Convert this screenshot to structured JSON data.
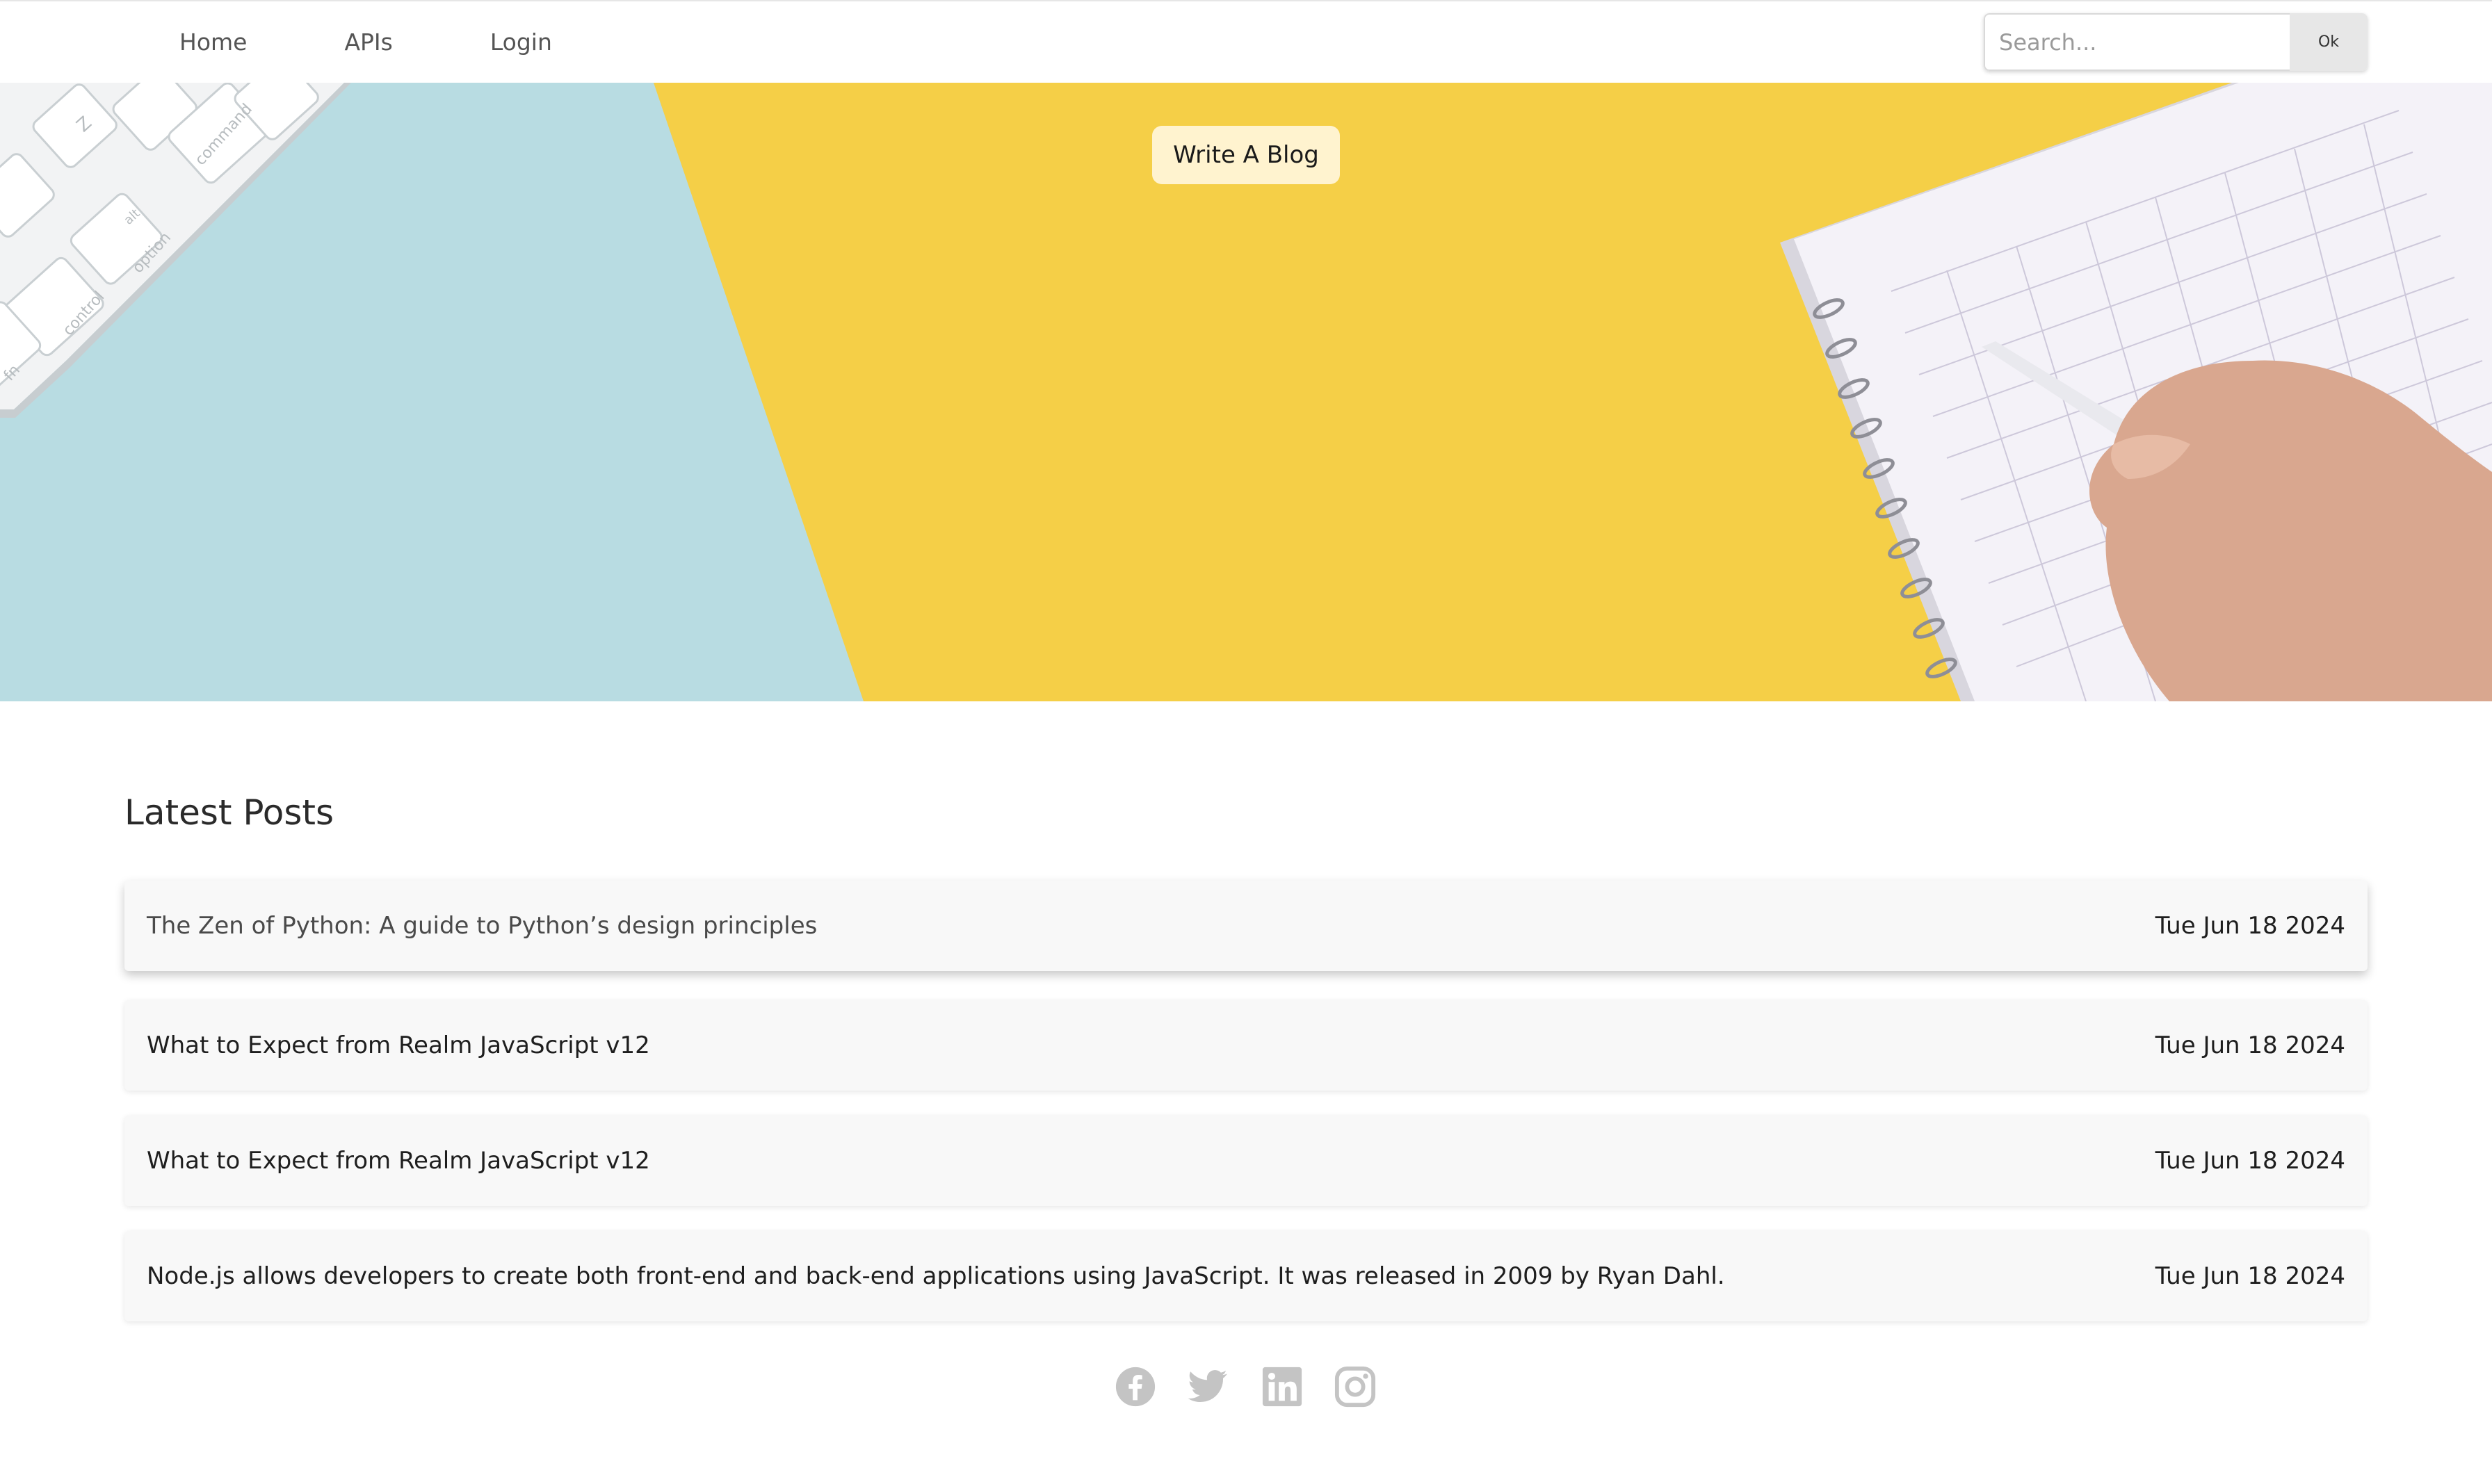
{
  "nav": {
    "links": [
      {
        "label": "Home"
      },
      {
        "label": "APIs"
      },
      {
        "label": "Login"
      }
    ],
    "search": {
      "placeholder": "Search...",
      "button_label": "Ok"
    }
  },
  "hero": {
    "write_blog_label": "Write A Blog",
    "keyboard_keys": [
      "Z",
      "alt",
      "option",
      "control",
      "command",
      "fn"
    ]
  },
  "posts": {
    "title": "Latest Posts",
    "items": [
      {
        "title": "The Zen of Python: A guide to Python’s design principles",
        "date": "Tue Jun 18 2024"
      },
      {
        "title": "What to Expect from Realm JavaScript v12",
        "date": "Tue Jun 18 2024"
      },
      {
        "title": "What to Expect from Realm JavaScript v12",
        "date": "Tue Jun 18 2024"
      },
      {
        "title": "Node.js allows developers to create both front-end and back-end applications using JavaScript. It was released in 2009 by Ryan Dahl.",
        "date": "Tue Jun 18 2024"
      }
    ]
  },
  "footer": {
    "social_icons": [
      "facebook-icon",
      "twitter-icon",
      "linkedin-icon",
      "instagram-icon"
    ],
    "icon_color": "#bdbdbd"
  },
  "colors": {
    "hero_yellow": "#f5cf47",
    "hero_blue": "#b8dce2",
    "button_bg": "#fff3cf",
    "card_bg": "#f8f8f8"
  }
}
